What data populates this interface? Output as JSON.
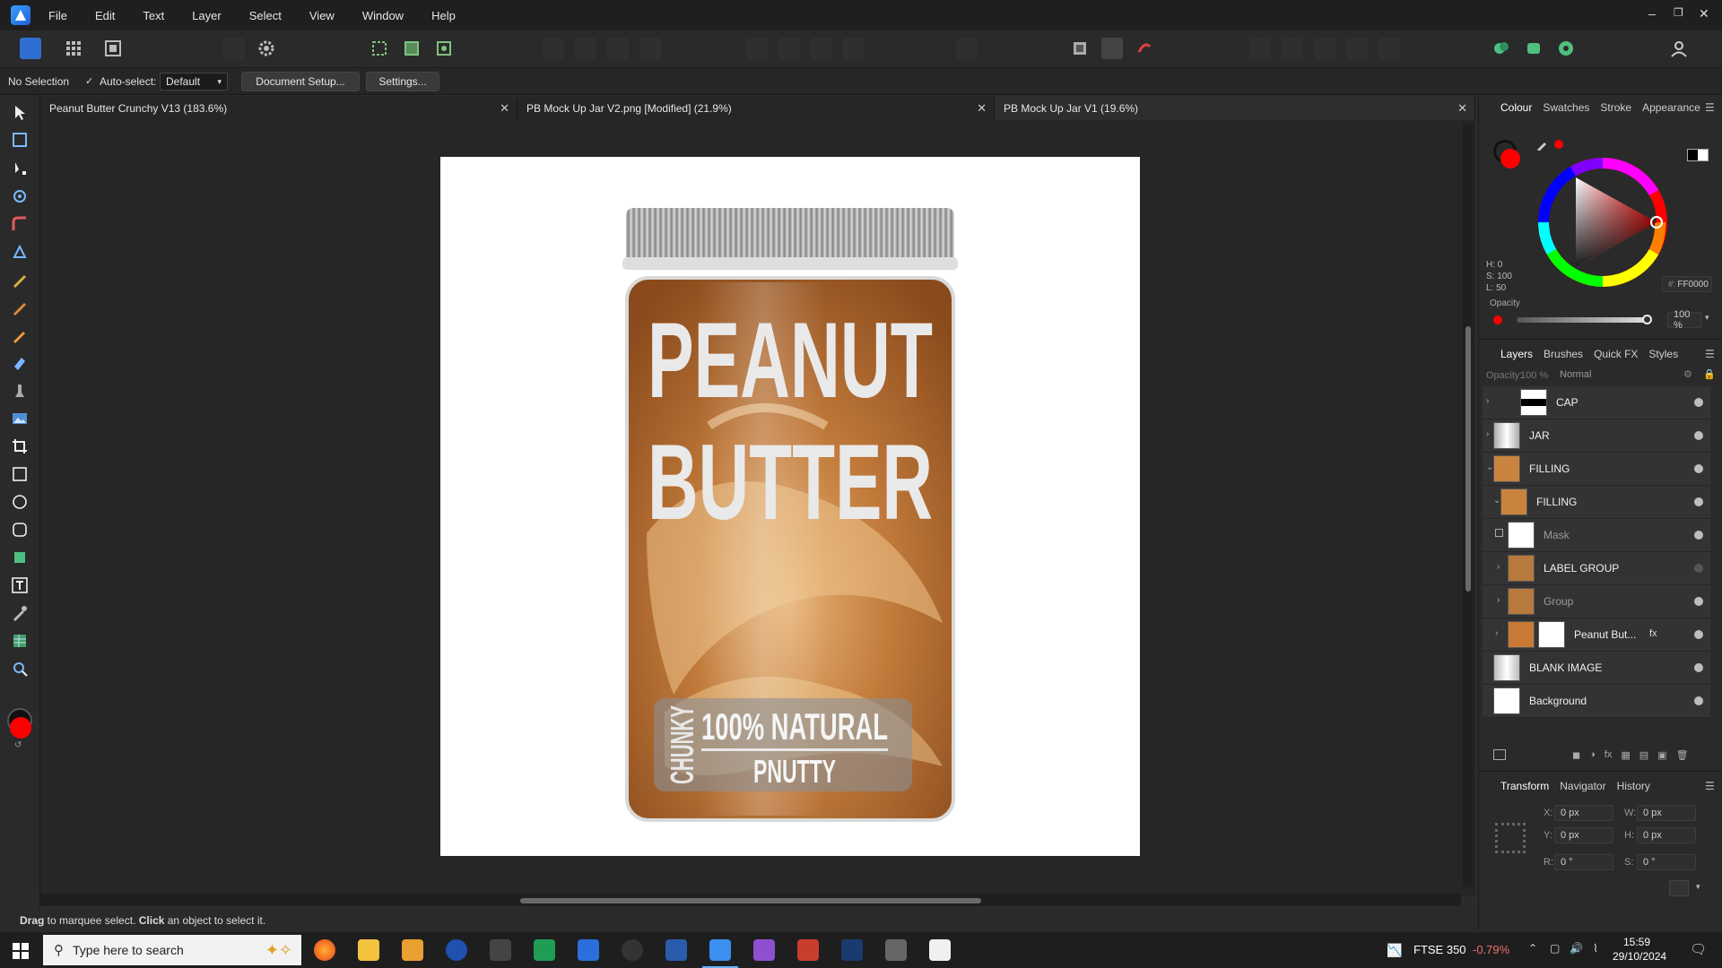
{
  "menubar": {
    "items": [
      "File",
      "Edit",
      "Text",
      "Layer",
      "Select",
      "View",
      "Window",
      "Help"
    ],
    "window_controls": [
      "–",
      "❐",
      "✕"
    ]
  },
  "contextbar": {
    "selection": "No Selection",
    "auto_select_label": "Auto-select:",
    "auto_select_value": "Default",
    "document_setup": "Document Setup...",
    "settings": "Settings..."
  },
  "tabs": [
    {
      "label": "Peanut Butter Crunchy V13 (183.6%)"
    },
    {
      "label": "PB Mock Up Jar V2.png [Modified] (21.9%)"
    },
    {
      "label": "PB Mock Up Jar V1 (19.6%)"
    }
  ],
  "artwork": {
    "line1": "PEANUT",
    "line2": "BUTTER",
    "side": "CHUNKY",
    "natural": "100% NATURAL",
    "brand": "PNUTTY"
  },
  "status": {
    "bold1": "Drag",
    "text1": " to marquee select. ",
    "bold2": "Click",
    "text2": " an object to select it."
  },
  "colour_panel": {
    "tabs": [
      "Colour",
      "Swatches",
      "Stroke",
      "Appearance"
    ],
    "h": "H: 0",
    "s": "S: 100",
    "l": "L: 50",
    "hex": "FF0000",
    "opacity_label": "Opacity",
    "opacity_value": "100 %",
    "colour": "#FF0000"
  },
  "layers_panel": {
    "tabs": [
      "Layers",
      "Brushes",
      "Quick FX",
      "Styles"
    ],
    "opacity_label": "Opacity:",
    "opacity_value": "100 %",
    "blend_mode": "Normal",
    "layers": [
      {
        "name": "CAP"
      },
      {
        "name": "JAR"
      },
      {
        "name": "FILLING"
      },
      {
        "name": "FILLING"
      },
      {
        "name": "Mask"
      },
      {
        "name": "LABEL GROUP"
      },
      {
        "name": "Group"
      },
      {
        "name": "Peanut But..."
      },
      {
        "name": "BLANK IMAGE"
      },
      {
        "name": "Background"
      }
    ]
  },
  "transform_panel": {
    "tabs": [
      "Transform",
      "Navigator",
      "History"
    ],
    "x_label": "X:",
    "x": "0 px",
    "y_label": "Y:",
    "y": "0 px",
    "w_label": "W:",
    "w": "0 px",
    "h_label": "H:",
    "h": "0 px",
    "r_label": "R:",
    "r": "0 °",
    "s_label": "S:",
    "s": "0 °"
  },
  "taskbar": {
    "search_placeholder": "Type here to search",
    "ticker": "FTSE 350",
    "change": "-0.79%",
    "time": "15:59",
    "date": "29/10/2024"
  }
}
